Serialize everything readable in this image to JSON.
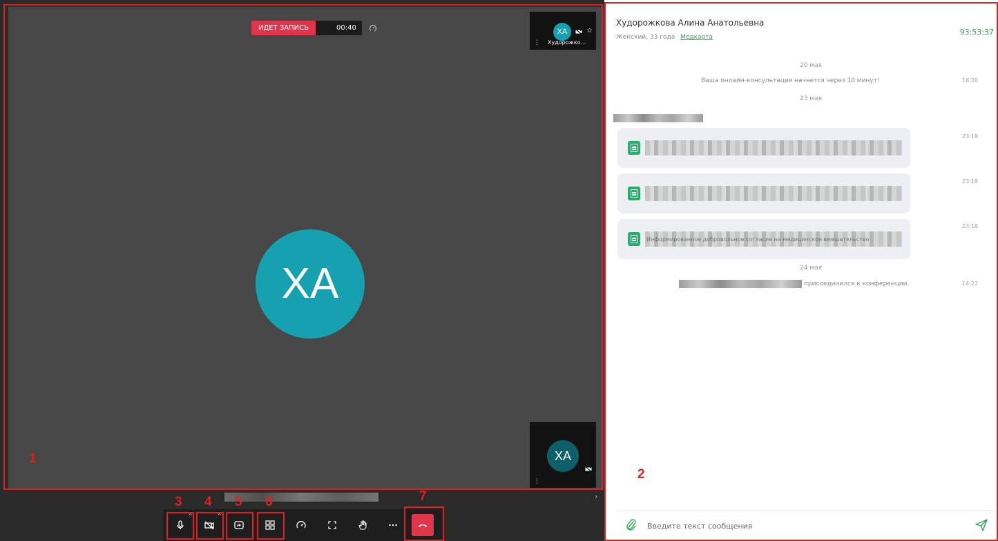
{
  "video": {
    "recording_label": "ИДЕТ ЗАПИСЬ",
    "recording_time": "00:40",
    "main_avatar_initials": "XA",
    "thumb_top": {
      "initials": "XA",
      "name": "Худорожко..."
    },
    "thumb_bottom": {
      "initials": "XA"
    }
  },
  "controls": [
    {
      "name": "microphone-button",
      "icon": "microphone-icon"
    },
    {
      "name": "camera-toggle-button",
      "icon": "camera-off-icon"
    },
    {
      "name": "screen-share-button",
      "icon": "screen-share-icon"
    },
    {
      "name": "layout-grid-button",
      "icon": "grid-icon"
    },
    {
      "name": "connection-speed-button",
      "icon": "gauge-icon"
    },
    {
      "name": "fullscreen-button",
      "icon": "fullscreen-icon"
    },
    {
      "name": "raise-hand-button",
      "icon": "hand-icon"
    },
    {
      "name": "more-button",
      "icon": "more-icon"
    },
    {
      "name": "hangup-button",
      "icon": "phone-hangup-icon"
    }
  ],
  "annotations": {
    "area1": "1",
    "area2": "2",
    "b3": "3",
    "b4": "4",
    "b5": "5",
    "b6": "6",
    "b7": "7"
  },
  "chat": {
    "patient_name": "Худорожкова Алина Анатольевна",
    "patient_info": "Женский, 33 года",
    "medcard_link": "Медкарта",
    "timer": "93:53:37",
    "date1": "20 мая",
    "system_msg1": "Ваша онлайн-консультация начнется через 10 минут!",
    "system_msg1_time": "16:20",
    "date2": "23 мая",
    "file1_time": "23:18",
    "file2_time": "23:18",
    "file3_time": "23:18",
    "file3_text": "Информированное добровольное согласие на медицинское вмешательство",
    "date3": "24 мая",
    "join_msg": "присоединился к конференции.",
    "join_time": "14:22",
    "input_placeholder": "Введите текст сообщения"
  },
  "colors": {
    "accent_green": "#31a553",
    "record_red": "#e0364c",
    "avatar_teal": "#16a1b0",
    "annotation_red": "#e02020"
  }
}
